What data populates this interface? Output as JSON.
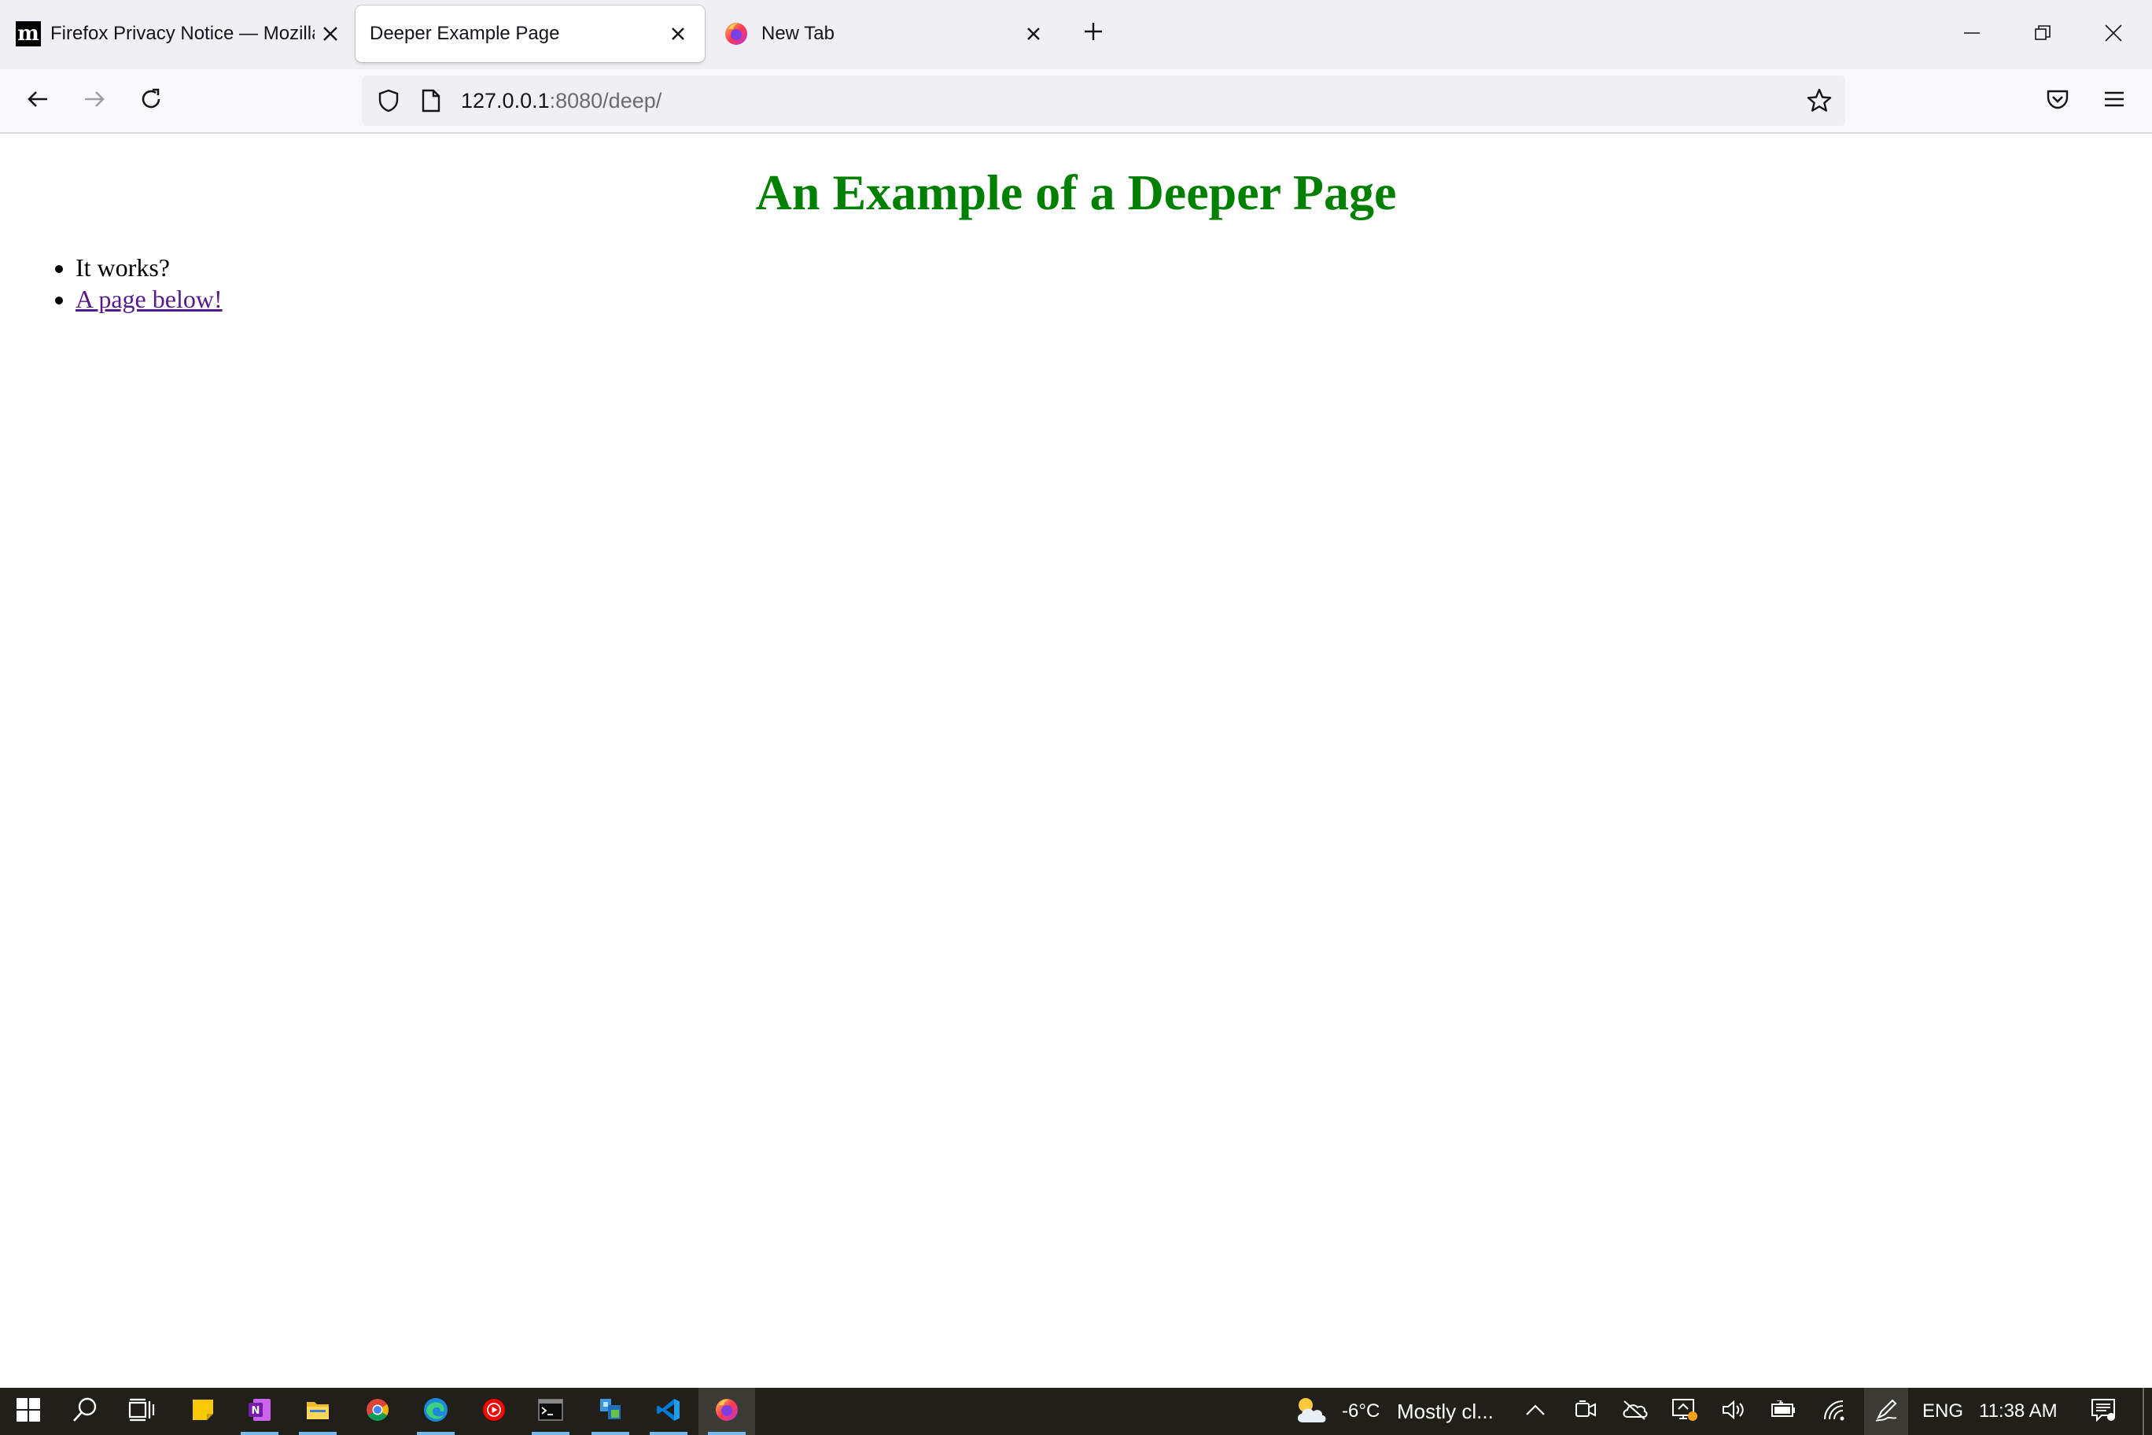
{
  "browser": {
    "tabs": [
      {
        "label": "Firefox Privacy Notice — Mozilla",
        "favicon": "mozilla-m-icon",
        "active": false
      },
      {
        "label": "Deeper Example Page",
        "favicon": "none",
        "active": true
      },
      {
        "label": "New Tab",
        "favicon": "firefox-icon",
        "active": false
      }
    ],
    "new_tab_icon": "plus-icon",
    "window_controls": [
      "minimize-icon",
      "restore-icon",
      "close-icon"
    ]
  },
  "navbar": {
    "url_host": "127.0.0.1",
    "url_rest": ":8080/deep/",
    "icons": [
      "back-arrow-icon",
      "forward-arrow-icon",
      "reload-icon",
      "shield-icon",
      "page-icon",
      "star-icon",
      "pocket-icon",
      "hamburger-menu-icon"
    ]
  },
  "page": {
    "heading": "An Example of a Deeper Page",
    "heading_color": "#008000",
    "items": [
      {
        "text": "It works?",
        "is_link": false
      },
      {
        "text": "A page below!",
        "is_link": true
      }
    ],
    "link_color": "#551a8b"
  },
  "taskbar": {
    "apps": [
      "windows-start-icon",
      "search-icon",
      "task-view-icon",
      "sticky-notes-icon",
      "onenote-icon",
      "file-explorer-icon",
      "chrome-icon",
      "edge-icon",
      "youtube-music-icon",
      "terminal-icon",
      "store-icon",
      "vscode-icon",
      "firefox-icon"
    ],
    "weather": {
      "temp": "-6°C",
      "summary": "Mostly cl..."
    },
    "language": "ENG",
    "time": "11:38 AM"
  }
}
